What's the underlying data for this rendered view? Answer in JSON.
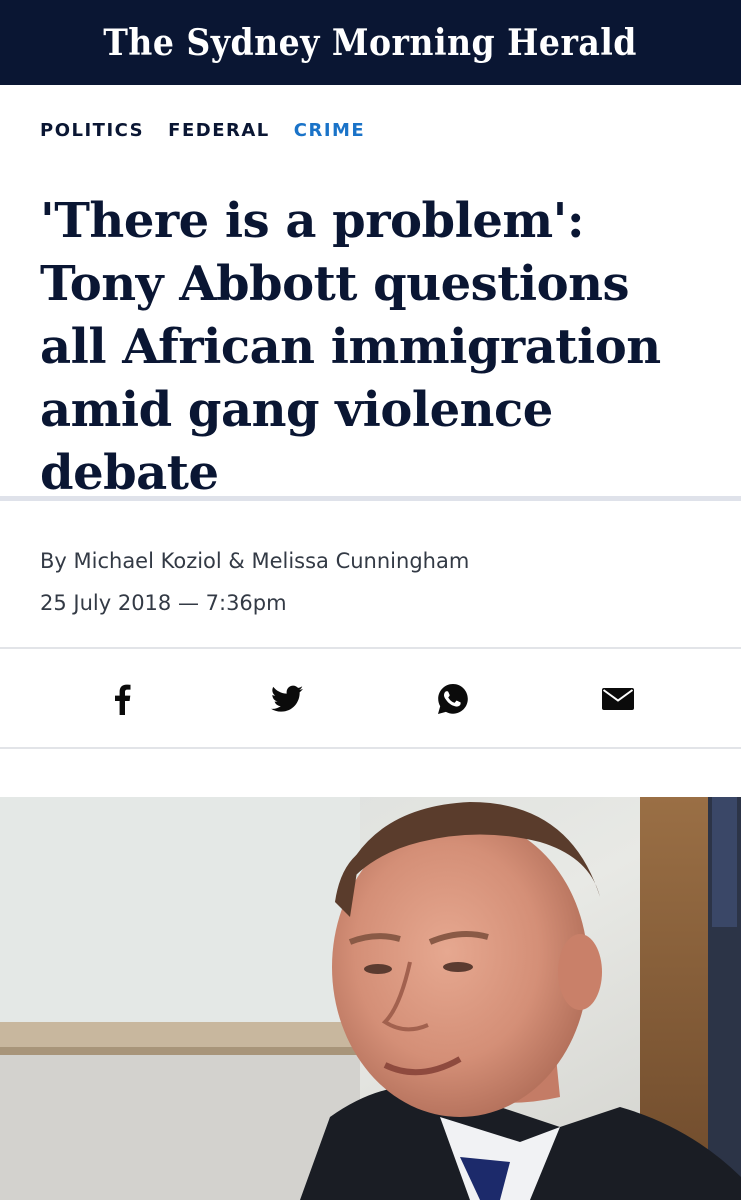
{
  "masthead": {
    "title": "The Sydney Morning Herald"
  },
  "sections": [
    {
      "label": "POLITICS",
      "active": false
    },
    {
      "label": "FEDERAL",
      "active": false
    },
    {
      "label": "CRIME",
      "active": true
    }
  ],
  "article": {
    "headline": "'There is a problem': Tony Abbott questions all African immigration amid gang violence debate",
    "byline": "By Michael Koziol & Melissa Cunningham",
    "dateline": "25 July 2018 — 7:36pm"
  },
  "share": {
    "icons": [
      "facebook-icon",
      "twitter-icon",
      "whatsapp-icon",
      "email-icon"
    ]
  },
  "colors": {
    "masthead_bg": "#0a1633",
    "headline": "#0a1633",
    "active_section": "#1a73c8"
  }
}
